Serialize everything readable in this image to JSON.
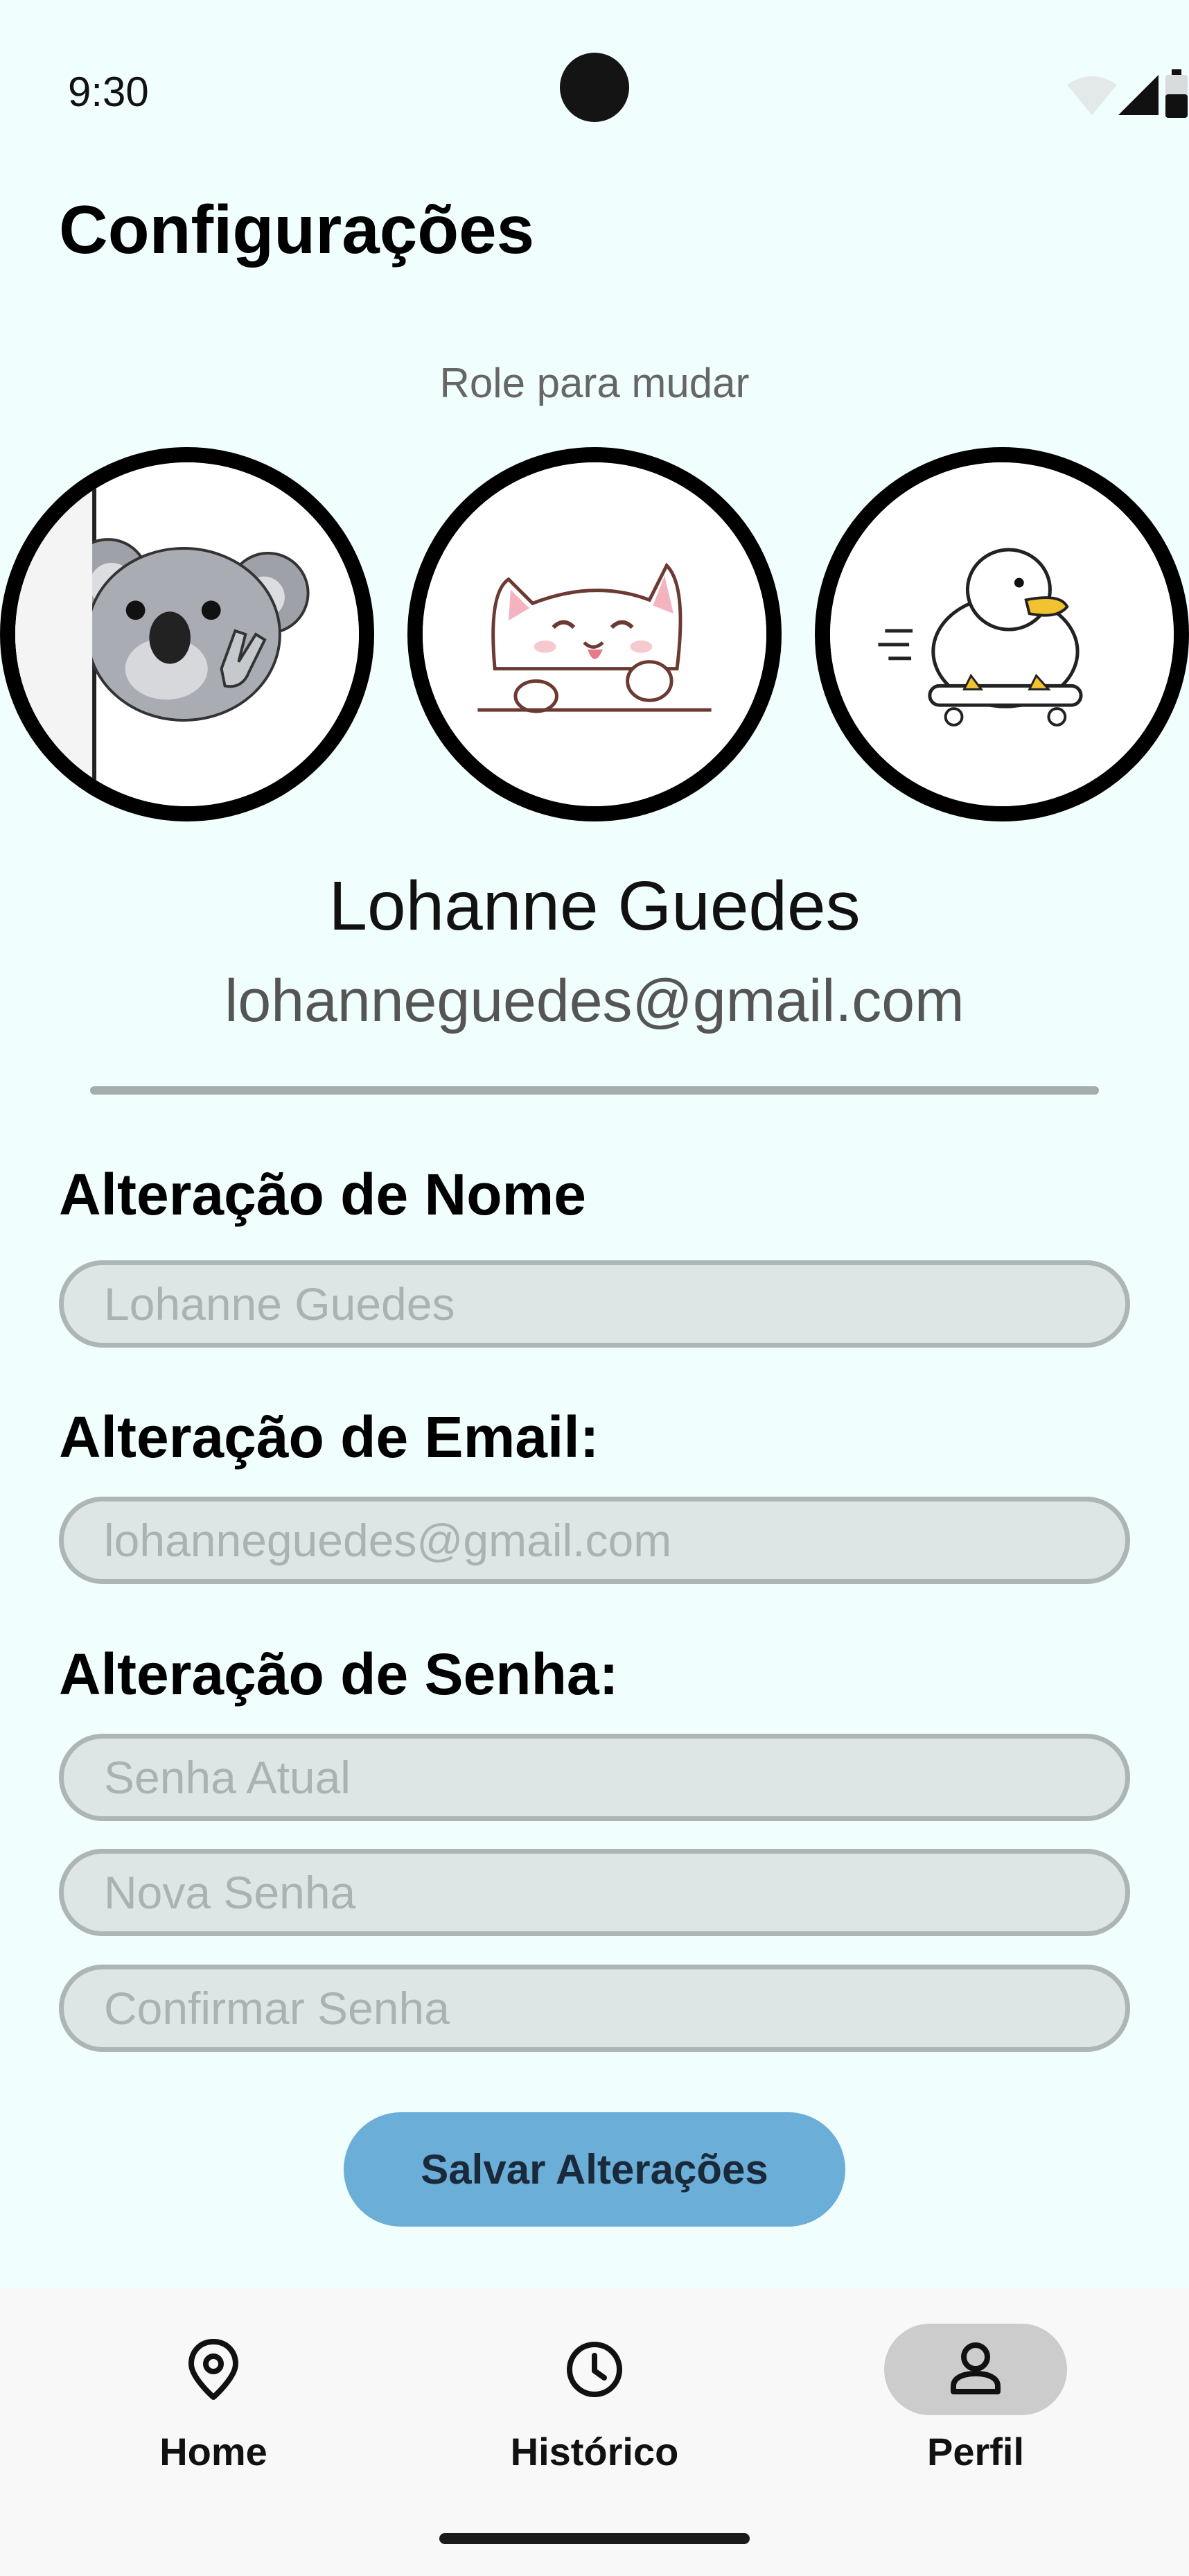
{
  "status_bar": {
    "time": "9:30",
    "icons": [
      "wifi-icon",
      "signal-icon",
      "battery-icon"
    ]
  },
  "header": {
    "title": "Configurações"
  },
  "avatar_picker": {
    "hint": "Role para mudar",
    "avatars": [
      {
        "name": "koala-avatar"
      },
      {
        "name": "cat-avatar"
      },
      {
        "name": "duck-avatar"
      }
    ]
  },
  "profile": {
    "name": "Lohanne Guedes",
    "email": "lohanneguedes@gmail.com"
  },
  "form": {
    "name_section": {
      "label": "Alteração de Nome",
      "placeholder": "Lohanne Guedes"
    },
    "email_section": {
      "label": "Alteração de Email:",
      "placeholder": "lohanneguedes@gmail.com"
    },
    "password_section": {
      "label": "Alteração de Senha:",
      "current_placeholder": "Senha Atual",
      "new_placeholder": "Nova Senha",
      "confirm_placeholder": "Confirmar Senha"
    },
    "save_label": "Salvar Alterações"
  },
  "bottom_nav": {
    "items": [
      {
        "label": "Home",
        "icon": "location-pin-icon",
        "active": false
      },
      {
        "label": "Histórico",
        "icon": "clock-icon",
        "active": false
      },
      {
        "label": "Perfil",
        "icon": "person-icon",
        "active": true
      }
    ]
  },
  "colors": {
    "background": "#f1fefe",
    "accent_button": "#6baed8",
    "field_fill": "#dde5e5",
    "field_border": "#aeb5b5",
    "active_nav_pill": "#cccccc"
  }
}
